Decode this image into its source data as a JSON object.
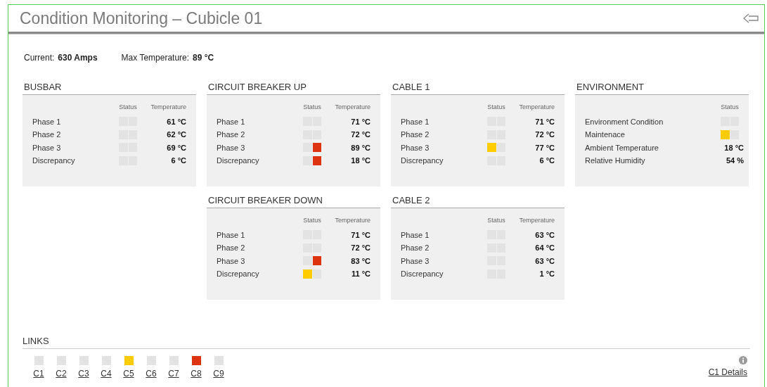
{
  "title": "Condition Monitoring – Cubicle 01",
  "summary": [
    {
      "label": "Current:",
      "value": "630 Amps"
    },
    {
      "label": "Max Temperature:",
      "value": "89 °C"
    }
  ],
  "rows": [
    {
      "panels": [
        {
          "title": "BUSBAR",
          "columns": [
            "Status",
            "Temperature"
          ],
          "items": [
            {
              "kind": "status",
              "label": "Phase 1",
              "warning": false,
              "alarm": false,
              "value": "61 °C"
            },
            {
              "kind": "status",
              "label": "Phase 2",
              "warning": false,
              "alarm": false,
              "value": "62 °C"
            },
            {
              "kind": "status",
              "label": "Phase 3",
              "warning": false,
              "alarm": false,
              "value": "69 °C"
            },
            {
              "kind": "status",
              "label": "Discrepancy",
              "warning": false,
              "alarm": false,
              "value": "6 °C"
            }
          ]
        },
        {
          "title": "CIRCUIT BREAKER UP",
          "columns": [
            "Status",
            "Temperature"
          ],
          "items": [
            {
              "kind": "status",
              "label": "Phase 1",
              "warning": false,
              "alarm": false,
              "value": "71 °C"
            },
            {
              "kind": "status",
              "label": "Phase 2",
              "warning": false,
              "alarm": false,
              "value": "72 °C"
            },
            {
              "kind": "status",
              "label": "Phase 3",
              "warning": false,
              "alarm": true,
              "value": "89 °C"
            },
            {
              "kind": "status",
              "label": "Discrepancy",
              "warning": false,
              "alarm": true,
              "value": "18 °C"
            }
          ]
        },
        {
          "title": "CABLE 1",
          "columns": [
            "Status",
            "Temperature"
          ],
          "items": [
            {
              "kind": "status",
              "label": "Phase 1",
              "warning": false,
              "alarm": false,
              "value": "71 °C"
            },
            {
              "kind": "status",
              "label": "Phase 2",
              "warning": false,
              "alarm": false,
              "value": "72 °C"
            },
            {
              "kind": "status",
              "label": "Phase 3",
              "warning": true,
              "alarm": false,
              "value": "77 °C"
            },
            {
              "kind": "status",
              "label": "Discrepancy",
              "warning": false,
              "alarm": false,
              "value": "6 °C"
            }
          ]
        },
        {
          "title": "ENVIRONMENT",
          "columns": [
            "Status"
          ],
          "items": [
            {
              "kind": "status",
              "label": "Environment Condition",
              "warning": false,
              "alarm": false
            },
            {
              "kind": "status",
              "label": "Maintenace",
              "warning": true,
              "alarm": false
            },
            {
              "kind": "reading",
              "label": "Ambient Temperature",
              "value": "18 °C"
            },
            {
              "kind": "reading",
              "label": "Relative Humidity",
              "value": "54 %"
            }
          ]
        }
      ]
    },
    {
      "panels": [
        {
          "title": "CIRCUIT BREAKER DOWN",
          "columns": [
            "Status",
            "Temperature"
          ],
          "items": [
            {
              "kind": "status",
              "label": "Phase 1",
              "warning": false,
              "alarm": false,
              "value": "71 °C"
            },
            {
              "kind": "status",
              "label": "Phase 2",
              "warning": false,
              "alarm": false,
              "value": "72 °C"
            },
            {
              "kind": "status",
              "label": "Phase 3",
              "warning": false,
              "alarm": true,
              "value": "83 °C"
            },
            {
              "kind": "status",
              "label": "Discrepancy",
              "warning": true,
              "alarm": false,
              "value": "11 °C"
            }
          ]
        },
        {
          "title": "CABLE 2",
          "columns": [
            "Status",
            "Temperature"
          ],
          "items": [
            {
              "kind": "status",
              "label": "Phase 1",
              "warning": false,
              "alarm": false,
              "value": "63 °C"
            },
            {
              "kind": "status",
              "label": "Phase 2",
              "warning": false,
              "alarm": false,
              "value": "64 °C"
            },
            {
              "kind": "status",
              "label": "Phase 3",
              "warning": false,
              "alarm": false,
              "value": "63 °C"
            },
            {
              "kind": "status",
              "label": "Discrepancy",
              "warning": false,
              "alarm": false,
              "value": "1 °C"
            }
          ]
        }
      ]
    }
  ],
  "links": {
    "title": "LINKS",
    "items": [
      {
        "label": "C1",
        "warning": false,
        "alarm": false
      },
      {
        "label": "C2",
        "warning": false,
        "alarm": false
      },
      {
        "label": "C3",
        "warning": false,
        "alarm": false
      },
      {
        "label": "C4",
        "warning": false,
        "alarm": false
      },
      {
        "label": "C5",
        "warning": true,
        "alarm": false
      },
      {
        "label": "C6",
        "warning": false,
        "alarm": false
      },
      {
        "label": "C7",
        "warning": false,
        "alarm": false
      },
      {
        "label": "C8",
        "warning": false,
        "alarm": true
      },
      {
        "label": "C9",
        "warning": false,
        "alarm": false
      }
    ],
    "details": "C1 Details"
  }
}
